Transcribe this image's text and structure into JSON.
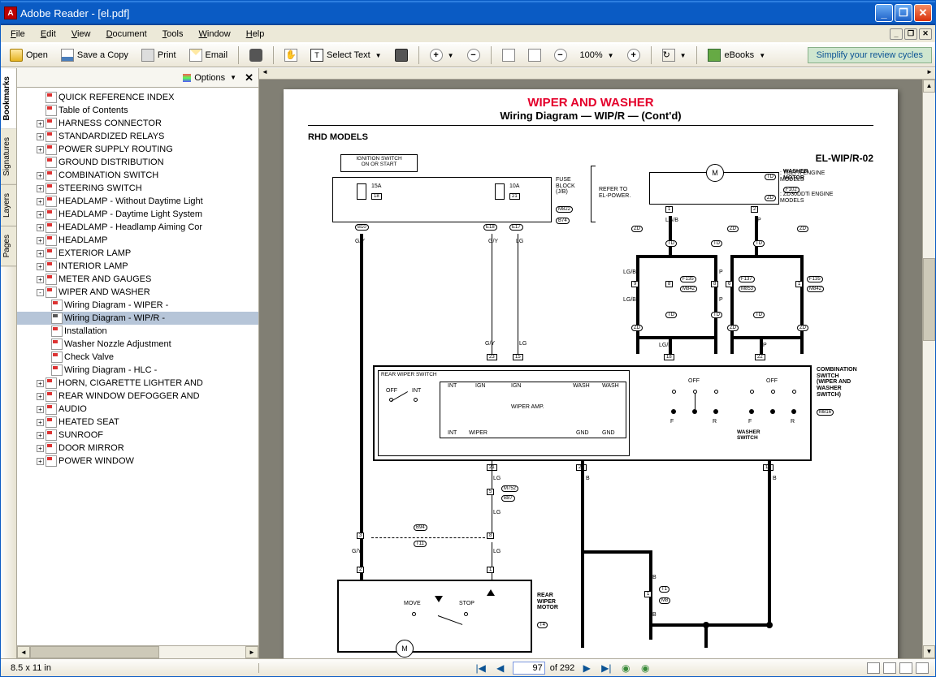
{
  "window_title": "Adobe Reader - [el.pdf]",
  "menu": {
    "file": "File",
    "edit": "Edit",
    "view": "View",
    "document": "Document",
    "tools": "Tools",
    "window": "Window",
    "help": "Help"
  },
  "toolbar": {
    "open": "Open",
    "save": "Save a Copy",
    "print": "Print",
    "email": "Email",
    "select": "Select Text",
    "zoom": "100%",
    "ebooks": "eBooks",
    "review": "Simplify your review cycles"
  },
  "tabs": {
    "bookmarks": "Bookmarks",
    "signatures": "Signatures",
    "layers": "Layers",
    "pages": "Pages"
  },
  "bm_head": {
    "options": "Options"
  },
  "bookmarks": [
    {
      "t": "QUICK REFERENCE INDEX",
      "e": ""
    },
    {
      "t": "Table of Contents",
      "e": ""
    },
    {
      "t": "HARNESS CONNECTOR",
      "e": "+"
    },
    {
      "t": "STANDARDIZED RELAYS",
      "e": "+"
    },
    {
      "t": "POWER SUPPLY ROUTING",
      "e": "+"
    },
    {
      "t": "GROUND DISTRIBUTION",
      "e": ""
    },
    {
      "t": "COMBINATION SWITCH",
      "e": "+"
    },
    {
      "t": "STEERING SWITCH",
      "e": "+"
    },
    {
      "t": "HEADLAMP - Without Daytime Light",
      "e": "+"
    },
    {
      "t": "HEADLAMP - Daytime Light System",
      "e": "+"
    },
    {
      "t": "HEADLAMP - Headlamp Aiming Cor",
      "e": "+"
    },
    {
      "t": "HEADLAMP",
      "e": "+"
    },
    {
      "t": "EXTERIOR LAMP",
      "e": "+"
    },
    {
      "t": "INTERIOR LAMP",
      "e": "+"
    },
    {
      "t": "METER AND GAUGES",
      "e": "+"
    },
    {
      "t": "WIPER AND WASHER",
      "e": "-",
      "children": [
        {
          "t": "Wiring Diagram - WIPER -"
        },
        {
          "t": "Wiring Diagram - WIP/R -",
          "sel": true
        },
        {
          "t": "Installation"
        },
        {
          "t": "Washer Nozzle Adjustment"
        },
        {
          "t": "Check Valve"
        },
        {
          "t": "Wiring Diagram - HLC -"
        }
      ]
    },
    {
      "t": "HORN, CIGARETTE LIGHTER AND",
      "e": "+"
    },
    {
      "t": "REAR WINDOW DEFOGGER AND",
      "e": "+"
    },
    {
      "t": "AUDIO",
      "e": "+"
    },
    {
      "t": "HEATED SEAT",
      "e": "+"
    },
    {
      "t": "SUNROOF",
      "e": "+"
    },
    {
      "t": "DOOR MIRROR",
      "e": "+"
    },
    {
      "t": "POWER WINDOW",
      "e": "+"
    }
  ],
  "status": {
    "dims": "8.5 x 11 in",
    "page": "97",
    "total": "of 292"
  },
  "diagram": {
    "title": "WIPER AND WASHER",
    "subtitle": "Wiring Diagram — WIP/R — (Cont'd)",
    "lh": "RHD MODELS",
    "id": "EL-WIP/R-02",
    "ign": "IGNITION SWITCH\nON OR START",
    "fuse1": "15A",
    "fuse1b": "18",
    "fuse2": "10A",
    "fuse2b": "21",
    "fb": "FUSE\nBLOCK\n(J/B)",
    "refer": "REFER TO\nEL-POWER.",
    "washer": "WASHER\nMOTOR",
    "washerc": "F102",
    "td": ": TD27Ti ENGINE\n  MODELS",
    "zd": ": ZD30DDTi ENGINE\n  MODELS",
    "gy": "G/Y",
    "lg": "LG",
    "lgb": "LG/B",
    "p": "P",
    "b": "B",
    "rws": "REAR WIPER SWITCH",
    "wamp": "WIPER AMP.",
    "off": "OFF",
    "int": "INT",
    "ign2": "IGN",
    "wash": "WASH",
    "wiper": "WIPER",
    "gnd": "GND",
    "f": "F",
    "r": "R",
    "comb": "COMBINATION\nSWITCH\n(WIPER AND\nWASHER\nSWITCH)",
    "combc": "M816",
    "washsw": "WASHER\nSWITCH",
    "rwm": "REAR\nWIPER\nMOTOR",
    "move": "MOVE",
    "stop": "STOP",
    "c": {
      "b10": "B10",
      "e18": "E18",
      "e17": "E17",
      "m822": "M822",
      "b74": "B74",
      "m842": "M842",
      "m853": "M853",
      "f135": "F135",
      "f137": "F137",
      "n23": "23",
      "n15": "15",
      "n18": "18",
      "n22": "22",
      "n21": "21",
      "n24": "24",
      "n17": "17",
      "n5": "5",
      "n3": "3",
      "n8": "8",
      "n2": "2",
      "n9": "9",
      "n1": "1",
      "m752": "M752",
      "b87": "B87",
      "b94": "B94",
      "t11": "T11",
      "t4": "T4",
      "t1": "T1",
      "m8": "M8"
    }
  }
}
